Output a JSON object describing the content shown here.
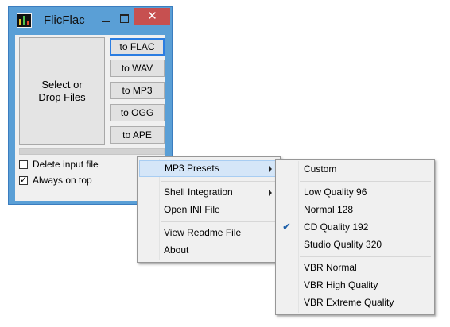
{
  "window": {
    "title": "FlicFlac",
    "close_glyph": "✕"
  },
  "main": {
    "select_button": {
      "line1": "Select or",
      "line2": "Drop Files"
    },
    "convert_buttons": [
      "to FLAC",
      "to WAV",
      "to MP3",
      "to OGG",
      "to APE"
    ],
    "checkboxes": [
      {
        "label": "Delete input file",
        "checked": false
      },
      {
        "label": "Always on top",
        "checked": true
      }
    ]
  },
  "context_menu": {
    "items": [
      {
        "label": "MP3 Presets",
        "submenu": true,
        "highlighted": true
      },
      {
        "label": "Shell Integration",
        "submenu": true
      },
      {
        "label": "Open INI File"
      },
      {
        "label": "View Readme File"
      },
      {
        "label": "About"
      }
    ]
  },
  "presets_menu": {
    "items": [
      {
        "label": "Custom"
      },
      {
        "label": "Low Quality 96"
      },
      {
        "label": "Normal 128"
      },
      {
        "label": "CD Quality 192",
        "checked": true
      },
      {
        "label": "Studio Quality 320"
      },
      {
        "label": "VBR Normal"
      },
      {
        "label": "VBR High Quality"
      },
      {
        "label": "VBR Extreme Quality"
      }
    ],
    "check_glyph": "✔"
  }
}
